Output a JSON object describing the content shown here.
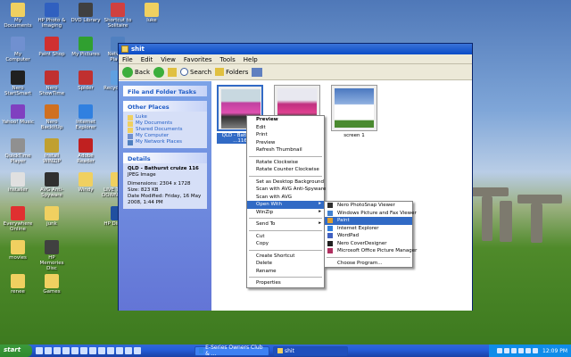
{
  "desktop": {
    "icons": [
      {
        "label": "My Documents",
        "color": "#f0d060"
      },
      {
        "label": "HP Photo & Imaging",
        "color": "#3060c0"
      },
      {
        "label": "DVD Library",
        "color": "#404040"
      },
      {
        "label": "Shortcut to Solitaire",
        "color": "#d04040"
      },
      {
        "label": "luke",
        "color": "#f0d060"
      },
      {
        "label": "My Computer",
        "color": "#7090d0"
      },
      {
        "label": "Paint Shop",
        "color": "#d03030"
      },
      {
        "label": "My Pictures",
        "color": "#30a030"
      },
      {
        "label": "Network Places",
        "color": "#5080c0"
      },
      {
        "label": "Nero StartSmart",
        "color": "#202020"
      },
      {
        "label": "Nero ShowTime",
        "color": "#c03030"
      },
      {
        "label": "Spider",
        "color": "#c03030"
      },
      {
        "label": "Recycle Bin",
        "color": "#60a0e0"
      },
      {
        "label": "Yahoo! Music",
        "color": "#8040c0"
      },
      {
        "label": "Nero BackItUp",
        "color": "#d07020"
      },
      {
        "label": "Internet Explorer",
        "color": "#3080e0"
      },
      {
        "label": "QuickTime Player",
        "color": "#909090"
      },
      {
        "label": "Install WINZIP",
        "color": "#c0a030"
      },
      {
        "label": "Adobe Reader",
        "color": "#c02020"
      },
      {
        "label": "installer",
        "color": "#e0e0e0"
      },
      {
        "label": "AVG Anti-Spyware",
        "color": "#303030"
      },
      {
        "label": "Windy",
        "color": "#f0d060"
      },
      {
        "label": "LIVE TRACK DOWNLOADS",
        "color": "#f0d060"
      },
      {
        "label": "Everywhere Online",
        "color": "#e03030"
      },
      {
        "label": "junk",
        "color": "#f0d060"
      },
      {
        "label": "HP Director",
        "color": "#2050a0"
      },
      {
        "label": "movies",
        "color": "#f0d060"
      },
      {
        "label": "HP Memories Disc",
        "color": "#404040"
      },
      {
        "label": "renee",
        "color": "#f0d060"
      },
      {
        "label": "Games",
        "color": "#f0d060"
      }
    ]
  },
  "window": {
    "title": "shit",
    "menu": [
      "File",
      "Edit",
      "View",
      "Favorites",
      "Tools",
      "Help"
    ],
    "toolbar": {
      "back": "Back",
      "search": "Search",
      "folders": "Folders"
    }
  },
  "leftpane": {
    "tasks_title": "File and Folder Tasks",
    "other_title": "Other Places",
    "other_items": [
      "Luke",
      "My Documents",
      "Shared Documents",
      "My Computer",
      "My Network Places"
    ],
    "details_title": "Details",
    "details": {
      "name": "QLD - Bathurst cruize 116",
      "type": "JPEG Image",
      "dimensions": "Dimensions: 2304 x 1728",
      "size": "Size: 823 KB",
      "modified": "Date Modified: Friday, 16 May 2008, 1:44 PM"
    }
  },
  "thumbs": [
    {
      "label": "QLD - Bathurst ...116",
      "selected": true
    },
    {
      "label": "",
      "selected": false
    },
    {
      "label": "screen 1",
      "selected": false
    }
  ],
  "context_menu": {
    "items": [
      {
        "label": "Preview",
        "bold": true
      },
      {
        "label": "Edit"
      },
      {
        "label": "Print"
      },
      {
        "label": "Preview"
      },
      {
        "label": "Refresh Thumbnail"
      },
      {
        "sep": true
      },
      {
        "label": "Rotate Clockwise"
      },
      {
        "label": "Rotate Counter Clockwise"
      },
      {
        "sep": true
      },
      {
        "label": "Set as Desktop Background"
      },
      {
        "label": "Scan with AVG Anti-Spyware"
      },
      {
        "label": "Scan with AVG"
      },
      {
        "label": "Open With",
        "arrow": true,
        "highlight": true
      },
      {
        "label": "WinZip",
        "arrow": true
      },
      {
        "sep": true
      },
      {
        "label": "Send To",
        "arrow": true
      },
      {
        "sep": true
      },
      {
        "label": "Cut"
      },
      {
        "label": "Copy"
      },
      {
        "sep": true
      },
      {
        "label": "Create Shortcut"
      },
      {
        "label": "Delete"
      },
      {
        "label": "Rename"
      },
      {
        "sep": true
      },
      {
        "label": "Properties"
      }
    ]
  },
  "open_with": {
    "items": [
      {
        "label": "Nero PhotoSnap Viewer",
        "color": "#303030"
      },
      {
        "label": "Windows Picture and Fax Viewer",
        "color": "#4080d0"
      },
      {
        "label": "Paint",
        "color": "#e0a030",
        "highlight": true
      },
      {
        "label": "Internet Explorer",
        "color": "#3080e0"
      },
      {
        "label": "WordPad",
        "color": "#4060c0"
      },
      {
        "label": "Nero CoverDesigner",
        "color": "#202020"
      },
      {
        "label": "Microsoft Office Picture Manager",
        "color": "#b03060"
      },
      {
        "sep": true
      },
      {
        "label": "Choose Program...",
        "color": ""
      }
    ]
  },
  "taskbar": {
    "start": "start",
    "tasks": [
      {
        "label": "E-Series Owners Club & ..."
      },
      {
        "label": "shit",
        "active": true
      }
    ],
    "clock": "12:09 PM"
  }
}
